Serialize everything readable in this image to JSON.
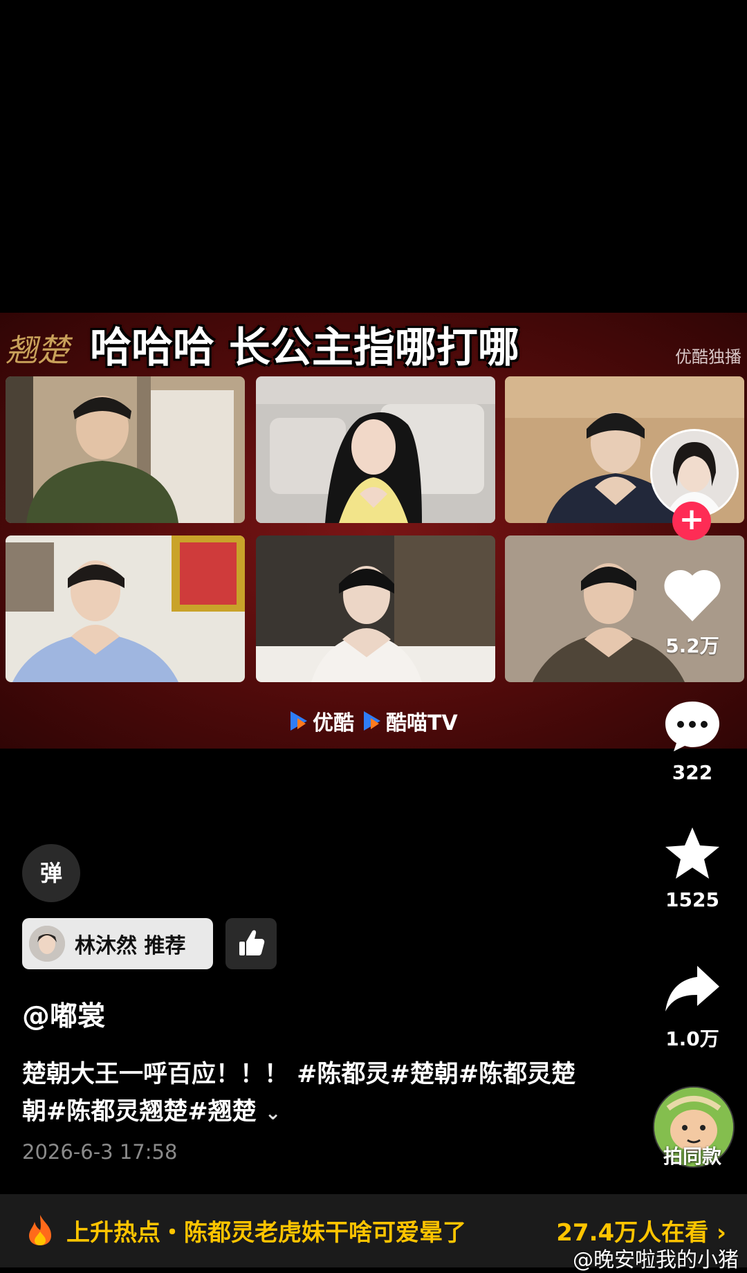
{
  "video": {
    "banner_title": "哈哈哈 长公主指哪打哪",
    "logo_text": "翘楚",
    "exclusive_label": "优酷独播",
    "brand_1": "优酷",
    "brand_2": "酷喵TV",
    "banner_color": "#5b0c0c"
  },
  "actions": {
    "likes": "5.2万",
    "comments": "322",
    "favorites": "1525",
    "shares": "1.0万",
    "follow_symbol": "+",
    "sound_label": "拍同款"
  },
  "info": {
    "danmu_label": "弹",
    "recommend_label": "林沐然 推荐",
    "username": "@嘟裳",
    "caption": "楚朝大王一呼百应！！！ #陈都灵#楚朝#陈都灵楚朝#陈都灵翘楚#翘楚",
    "caption_more": "⌄",
    "date": "2026-6-3 17:58"
  },
  "hot": {
    "text": "上升热点・陈都灵老虎妹干啥可爱晕了",
    "viewers": "27.4万人在看 ›",
    "accent": "#ffc400"
  },
  "watermark": "@晚安啦我的小猪"
}
